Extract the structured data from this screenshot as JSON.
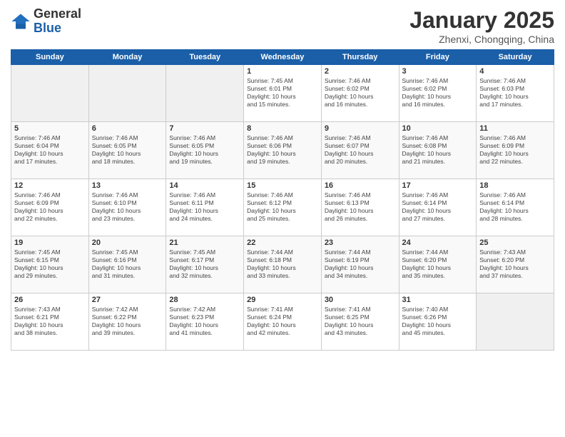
{
  "logo": {
    "general": "General",
    "blue": "Blue"
  },
  "title": "January 2025",
  "subtitle": "Zhenxi, Chongqing, China",
  "days_of_week": [
    "Sunday",
    "Monday",
    "Tuesday",
    "Wednesday",
    "Thursday",
    "Friday",
    "Saturday"
  ],
  "weeks": [
    [
      {
        "day": "",
        "info": ""
      },
      {
        "day": "",
        "info": ""
      },
      {
        "day": "",
        "info": ""
      },
      {
        "day": "1",
        "info": "Sunrise: 7:45 AM\nSunset: 6:01 PM\nDaylight: 10 hours\nand 15 minutes."
      },
      {
        "day": "2",
        "info": "Sunrise: 7:46 AM\nSunset: 6:02 PM\nDaylight: 10 hours\nand 16 minutes."
      },
      {
        "day": "3",
        "info": "Sunrise: 7:46 AM\nSunset: 6:02 PM\nDaylight: 10 hours\nand 16 minutes."
      },
      {
        "day": "4",
        "info": "Sunrise: 7:46 AM\nSunset: 6:03 PM\nDaylight: 10 hours\nand 17 minutes."
      }
    ],
    [
      {
        "day": "5",
        "info": "Sunrise: 7:46 AM\nSunset: 6:04 PM\nDaylight: 10 hours\nand 17 minutes."
      },
      {
        "day": "6",
        "info": "Sunrise: 7:46 AM\nSunset: 6:05 PM\nDaylight: 10 hours\nand 18 minutes."
      },
      {
        "day": "7",
        "info": "Sunrise: 7:46 AM\nSunset: 6:05 PM\nDaylight: 10 hours\nand 19 minutes."
      },
      {
        "day": "8",
        "info": "Sunrise: 7:46 AM\nSunset: 6:06 PM\nDaylight: 10 hours\nand 19 minutes."
      },
      {
        "day": "9",
        "info": "Sunrise: 7:46 AM\nSunset: 6:07 PM\nDaylight: 10 hours\nand 20 minutes."
      },
      {
        "day": "10",
        "info": "Sunrise: 7:46 AM\nSunset: 6:08 PM\nDaylight: 10 hours\nand 21 minutes."
      },
      {
        "day": "11",
        "info": "Sunrise: 7:46 AM\nSunset: 6:09 PM\nDaylight: 10 hours\nand 22 minutes."
      }
    ],
    [
      {
        "day": "12",
        "info": "Sunrise: 7:46 AM\nSunset: 6:09 PM\nDaylight: 10 hours\nand 22 minutes."
      },
      {
        "day": "13",
        "info": "Sunrise: 7:46 AM\nSunset: 6:10 PM\nDaylight: 10 hours\nand 23 minutes."
      },
      {
        "day": "14",
        "info": "Sunrise: 7:46 AM\nSunset: 6:11 PM\nDaylight: 10 hours\nand 24 minutes."
      },
      {
        "day": "15",
        "info": "Sunrise: 7:46 AM\nSunset: 6:12 PM\nDaylight: 10 hours\nand 25 minutes."
      },
      {
        "day": "16",
        "info": "Sunrise: 7:46 AM\nSunset: 6:13 PM\nDaylight: 10 hours\nand 26 minutes."
      },
      {
        "day": "17",
        "info": "Sunrise: 7:46 AM\nSunset: 6:14 PM\nDaylight: 10 hours\nand 27 minutes."
      },
      {
        "day": "18",
        "info": "Sunrise: 7:46 AM\nSunset: 6:14 PM\nDaylight: 10 hours\nand 28 minutes."
      }
    ],
    [
      {
        "day": "19",
        "info": "Sunrise: 7:45 AM\nSunset: 6:15 PM\nDaylight: 10 hours\nand 29 minutes."
      },
      {
        "day": "20",
        "info": "Sunrise: 7:45 AM\nSunset: 6:16 PM\nDaylight: 10 hours\nand 31 minutes."
      },
      {
        "day": "21",
        "info": "Sunrise: 7:45 AM\nSunset: 6:17 PM\nDaylight: 10 hours\nand 32 minutes."
      },
      {
        "day": "22",
        "info": "Sunrise: 7:44 AM\nSunset: 6:18 PM\nDaylight: 10 hours\nand 33 minutes."
      },
      {
        "day": "23",
        "info": "Sunrise: 7:44 AM\nSunset: 6:19 PM\nDaylight: 10 hours\nand 34 minutes."
      },
      {
        "day": "24",
        "info": "Sunrise: 7:44 AM\nSunset: 6:20 PM\nDaylight: 10 hours\nand 35 minutes."
      },
      {
        "day": "25",
        "info": "Sunrise: 7:43 AM\nSunset: 6:20 PM\nDaylight: 10 hours\nand 37 minutes."
      }
    ],
    [
      {
        "day": "26",
        "info": "Sunrise: 7:43 AM\nSunset: 6:21 PM\nDaylight: 10 hours\nand 38 minutes."
      },
      {
        "day": "27",
        "info": "Sunrise: 7:42 AM\nSunset: 6:22 PM\nDaylight: 10 hours\nand 39 minutes."
      },
      {
        "day": "28",
        "info": "Sunrise: 7:42 AM\nSunset: 6:23 PM\nDaylight: 10 hours\nand 41 minutes."
      },
      {
        "day": "29",
        "info": "Sunrise: 7:41 AM\nSunset: 6:24 PM\nDaylight: 10 hours\nand 42 minutes."
      },
      {
        "day": "30",
        "info": "Sunrise: 7:41 AM\nSunset: 6:25 PM\nDaylight: 10 hours\nand 43 minutes."
      },
      {
        "day": "31",
        "info": "Sunrise: 7:40 AM\nSunset: 6:26 PM\nDaylight: 10 hours\nand 45 minutes."
      },
      {
        "day": "",
        "info": ""
      }
    ]
  ]
}
